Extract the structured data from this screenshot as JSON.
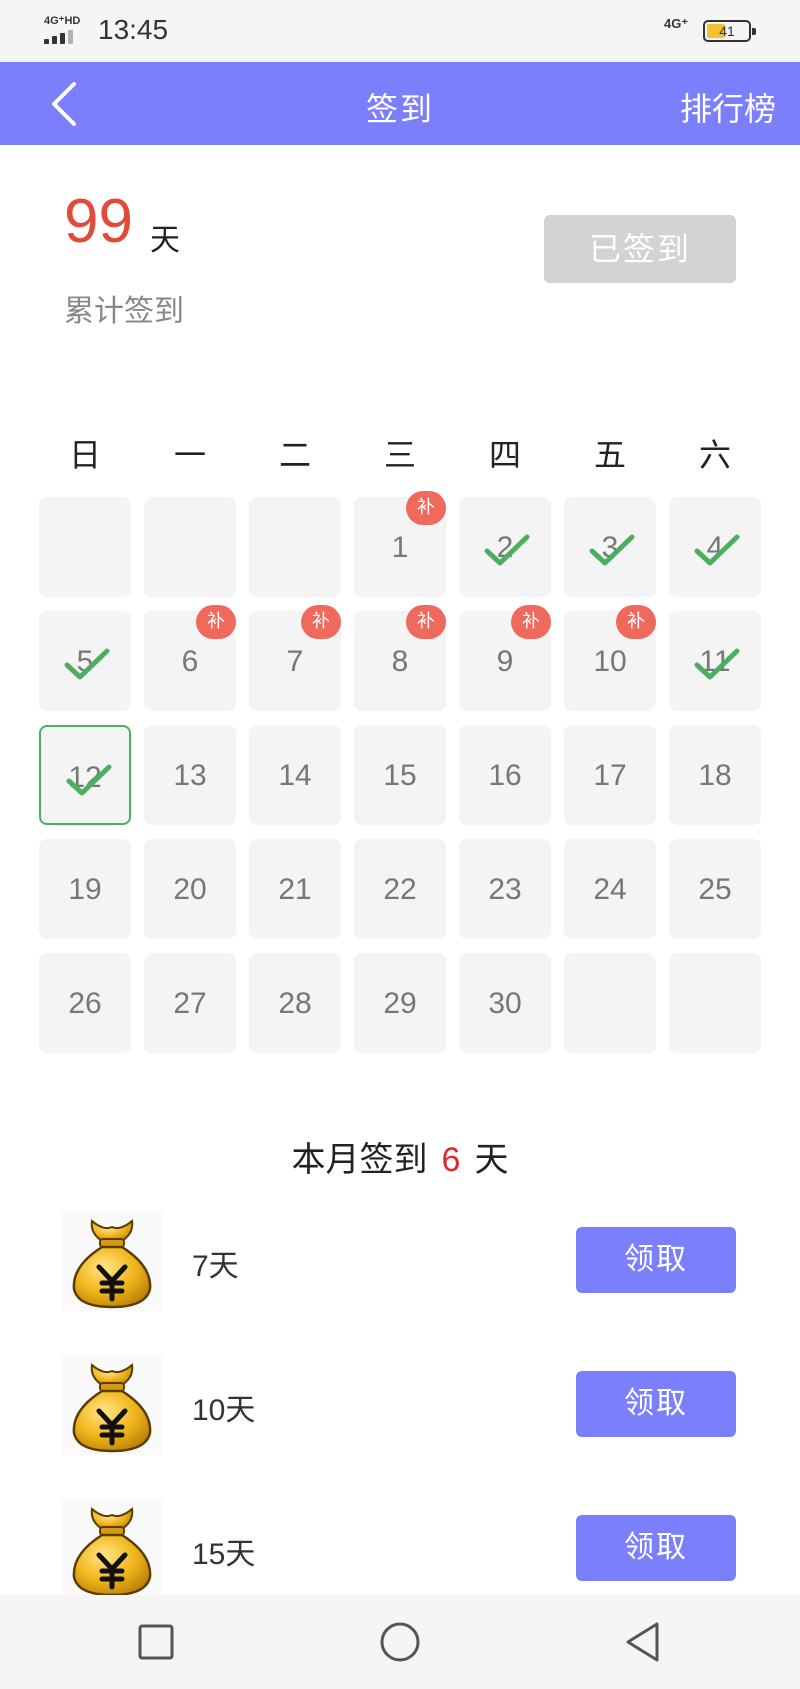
{
  "status_bar": {
    "network_left": "4G⁺HD",
    "time": "13:45",
    "network_right": "4G⁺",
    "battery_level": "41",
    "battery_fraction": 0.41
  },
  "header": {
    "back_icon": "chevron-left-icon",
    "title": "签到",
    "ranking_label": "排行榜",
    "background": "#7c7ffc"
  },
  "summary": {
    "total_days": "99",
    "unit": "天",
    "label": "累计签到",
    "signed_label": "已签到"
  },
  "calendar": {
    "weekdays": [
      "日",
      "一",
      "二",
      "三",
      "四",
      "五",
      "六"
    ],
    "leading_blanks": 3,
    "days_in_month": 30,
    "checked_days": [
      2,
      3,
      4,
      5,
      11,
      12
    ],
    "makeup_days": [
      1,
      6,
      7,
      8,
      9,
      10
    ],
    "today": 12,
    "makeup_badge": "补",
    "check_color": "#4caf60",
    "badge_color": "#ef6a5d"
  },
  "month_summary": {
    "prefix": "本月签到",
    "count": "6",
    "suffix": "天"
  },
  "rewards": [
    {
      "label": "7天",
      "button": "领取",
      "icon": "money-bag-icon"
    },
    {
      "label": "10天",
      "button": "领取",
      "icon": "money-bag-icon"
    },
    {
      "label": "15天",
      "button": "领取",
      "icon": "money-bag-icon"
    }
  ],
  "nav_bar": {
    "icons": [
      "square-icon",
      "circle-icon",
      "triangle-back-icon"
    ]
  }
}
